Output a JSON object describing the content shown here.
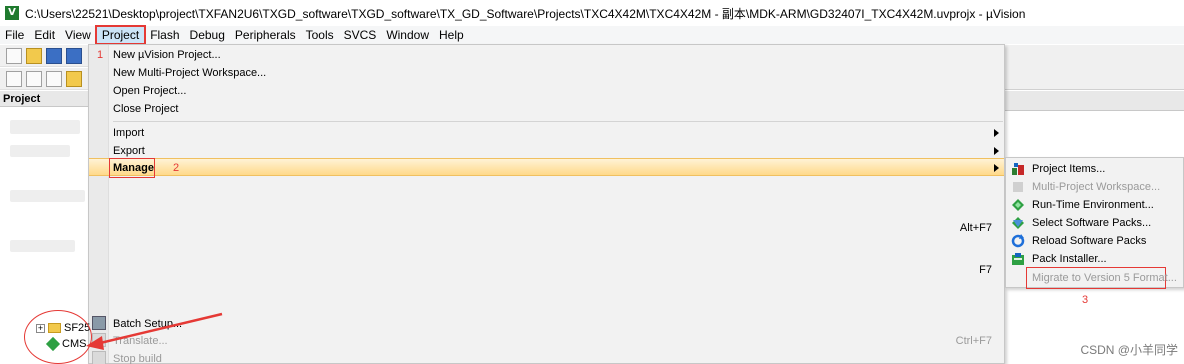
{
  "window": {
    "title": "C:\\Users\\22521\\Desktop\\project\\TXFAN2U6\\TXGD_software\\TXGD_software\\TX_GD_Software\\Projects\\TXC4X42M\\TXC4X42M - 副本\\MDK-ARM\\GD32407I_TXC4X42M.uvprojx - µVision"
  },
  "menubar": {
    "items": [
      "File",
      "Edit",
      "View",
      "Project",
      "Flash",
      "Debug",
      "Peripherals",
      "Tools",
      "SVCS",
      "Window",
      "Help"
    ],
    "active": "Project"
  },
  "project_panel": {
    "header": "Project"
  },
  "project_menu": {
    "new_project": "New µVision Project...",
    "new_multi": "New Multi-Project Workspace...",
    "open_project": "Open Project...",
    "close_project": "Close Project",
    "import": "Import",
    "export": "Export",
    "manage": "Manage",
    "shortcut_altf7": "Alt+F7",
    "shortcut_f7": "F7",
    "batch_setup": "Batch Setup...",
    "translate": "Translate...",
    "shortcut_ctrlf7": "Ctrl+F7",
    "stop_build": "Stop build"
  },
  "manage_submenu": {
    "project_items": "Project Items...",
    "multi_workspace": "Multi-Project Workspace...",
    "rte": "Run-Time Environment...",
    "select_packs": "Select Software Packs...",
    "reload_packs": "Reload Software Packs",
    "pack_installer": "Pack Installer...",
    "migrate": "Migrate to Version 5 Format..."
  },
  "annotations": {
    "step1": "1",
    "step2": "2",
    "step3": "3"
  },
  "tree": {
    "item1": "SF25",
    "item2": "CMS"
  },
  "watermark": "CSDN @小羊同学",
  "colors": {
    "annotation": "#e53935",
    "highlight": "#ffd98a",
    "menu_bg": "#f2f2f2"
  },
  "icons": {
    "project_items": "project-items-icon",
    "rte": "green-diamond-icon",
    "select_packs": "pack-select-icon",
    "reload_packs": "reload-icon",
    "pack_installer": "pack-installer-icon"
  }
}
